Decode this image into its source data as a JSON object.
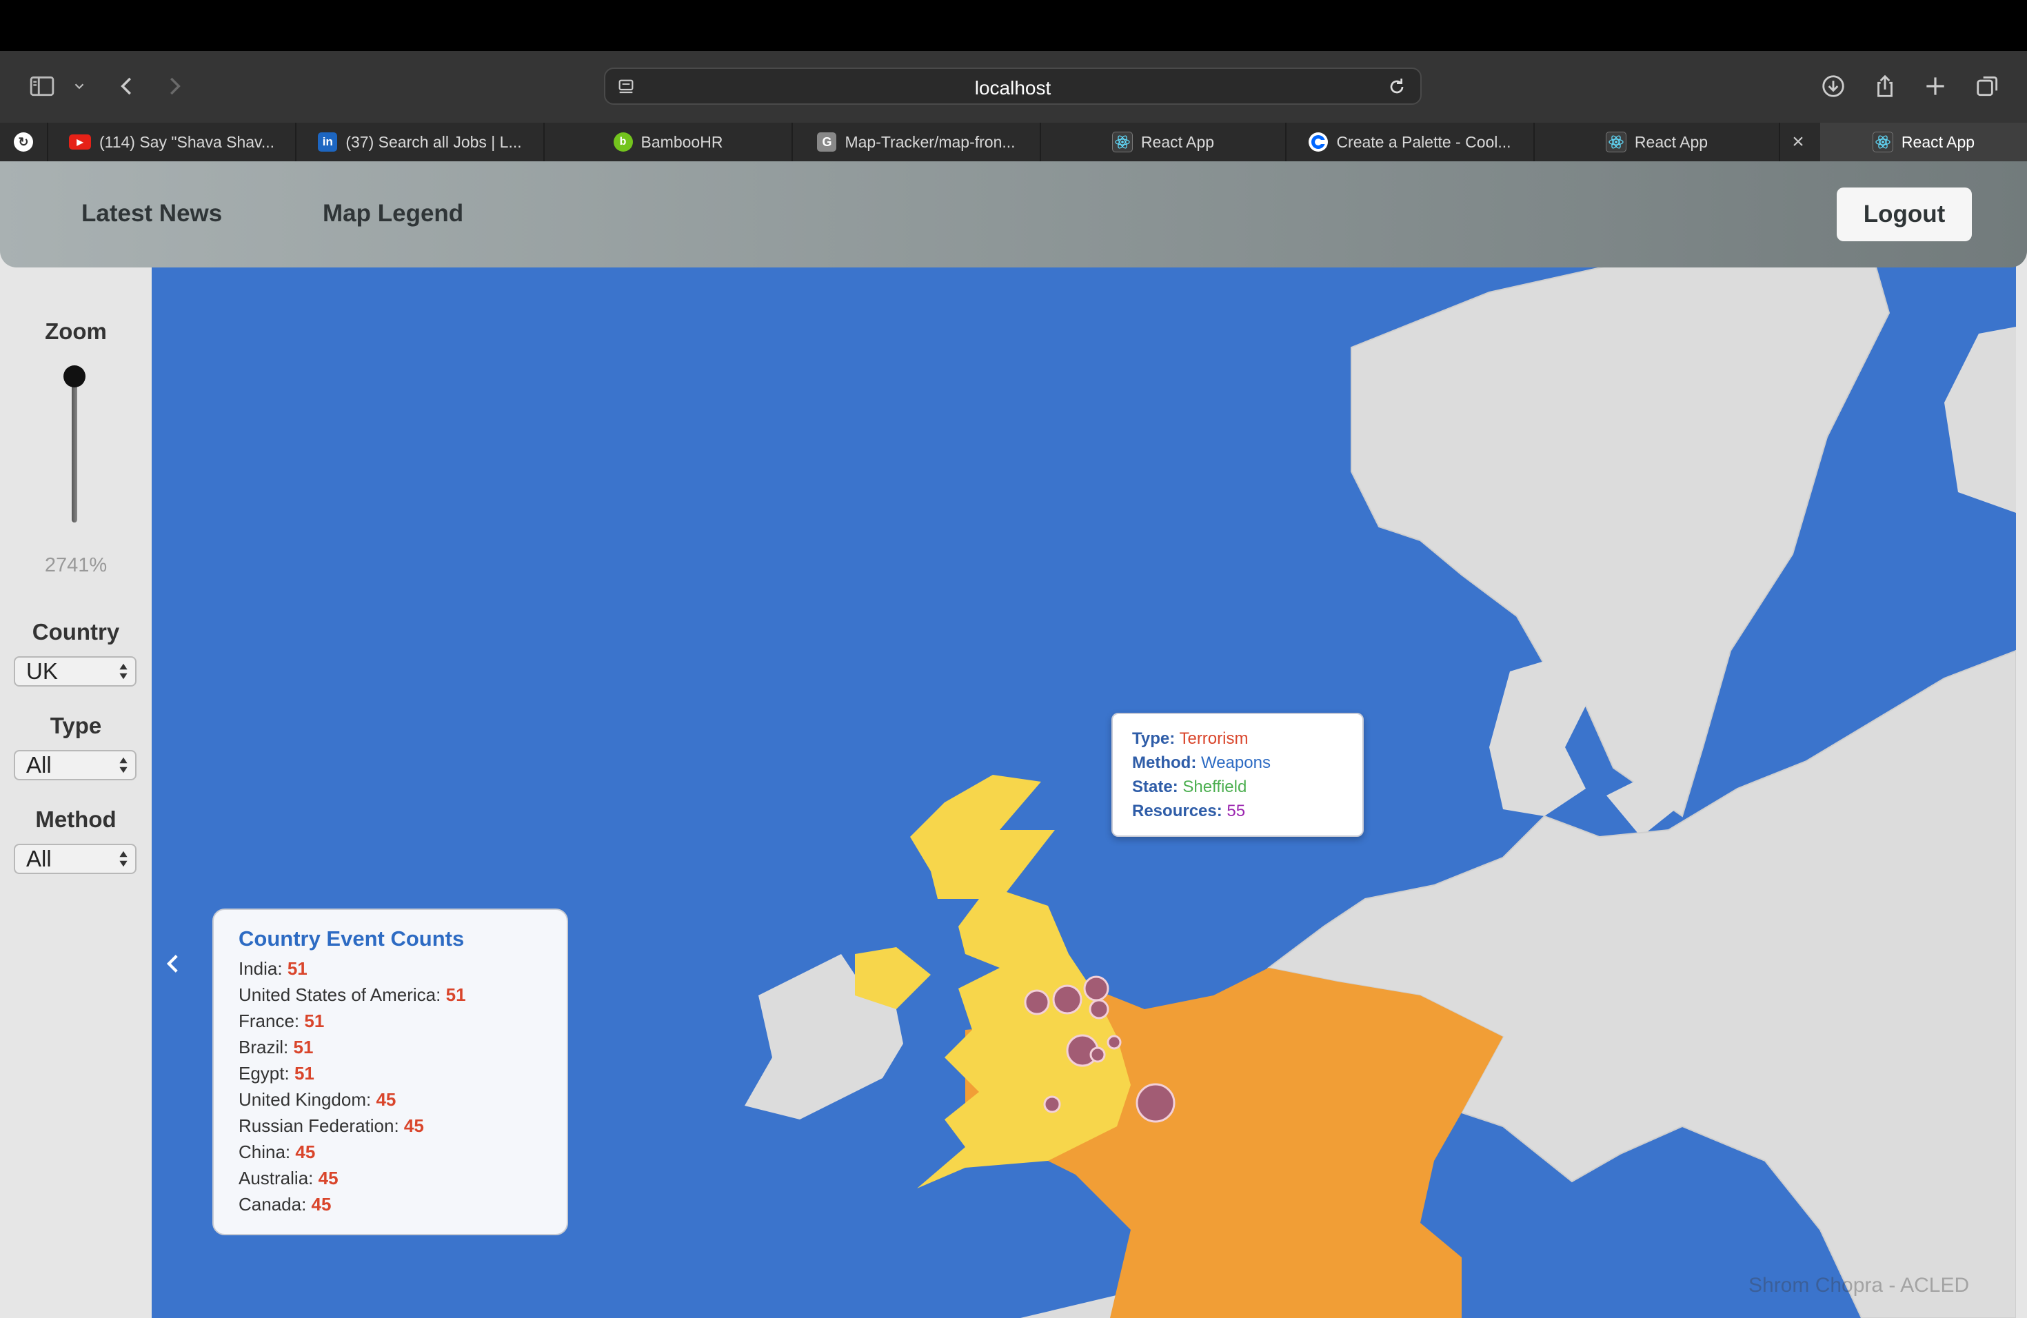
{
  "browser": {
    "url": "localhost",
    "tabs": [
      {
        "label": "",
        "favicon": "proton-icon"
      },
      {
        "label": "(114) Say \"Shava Shav...",
        "favicon": "youtube-icon"
      },
      {
        "label": "(37) Search all Jobs | L...",
        "favicon": "linkedin-icon"
      },
      {
        "label": "BambooHR",
        "favicon": "bamboohr-icon"
      },
      {
        "label": "Map-Tracker/map-fron...",
        "favicon": "github-icon"
      },
      {
        "label": "React App",
        "favicon": "react-icon"
      },
      {
        "label": "Create a Palette - Cool...",
        "favicon": "coolors-icon"
      },
      {
        "label": "React App",
        "favicon": "react-icon"
      },
      {
        "label": "React App",
        "favicon": "react-icon",
        "active": true
      }
    ],
    "close_tab_glyph": "×"
  },
  "header": {
    "latest_news": "Latest News",
    "map_legend": "Map Legend",
    "logout": "Logout"
  },
  "sidebar": {
    "zoom_label": "Zoom",
    "zoom_value": "2741%",
    "country_label": "Country",
    "country_value": "UK",
    "type_label": "Type",
    "type_value": "All",
    "method_label": "Method",
    "method_value": "All"
  },
  "tooltip": {
    "type_label": "Type:",
    "type_value": "Terrorism",
    "type_color": "#d9452b",
    "method_label": "Method:",
    "method_value": "Weapons",
    "method_color": "#2d6bc3",
    "state_label": "State:",
    "state_value": "Sheffield",
    "state_color": "#4caf50",
    "resources_label": "Resources:",
    "resources_value": "55",
    "resources_color": "#9c27b0"
  },
  "event_counts": {
    "title": "Country Event Counts",
    "rows": [
      {
        "country": "India:",
        "count": "51"
      },
      {
        "country": "United States of America:",
        "count": "51"
      },
      {
        "country": "France:",
        "count": "51"
      },
      {
        "country": "Brazil:",
        "count": "51"
      },
      {
        "country": "Egypt:",
        "count": "51"
      },
      {
        "country": "United Kingdom:",
        "count": "45"
      },
      {
        "country": "Russian Federation:",
        "count": "45"
      },
      {
        "country": "China:",
        "count": "45"
      },
      {
        "country": "Australia:",
        "count": "45"
      },
      {
        "country": "Canada:",
        "count": "45"
      }
    ]
  },
  "credit": "Shrom Chopra - ACLED",
  "colors": {
    "sea": "#3b74cc",
    "land": "#dcdcdc",
    "highlight_country": "#f7d64b",
    "france": "#f19e36",
    "event_marker": "#a25c74"
  }
}
